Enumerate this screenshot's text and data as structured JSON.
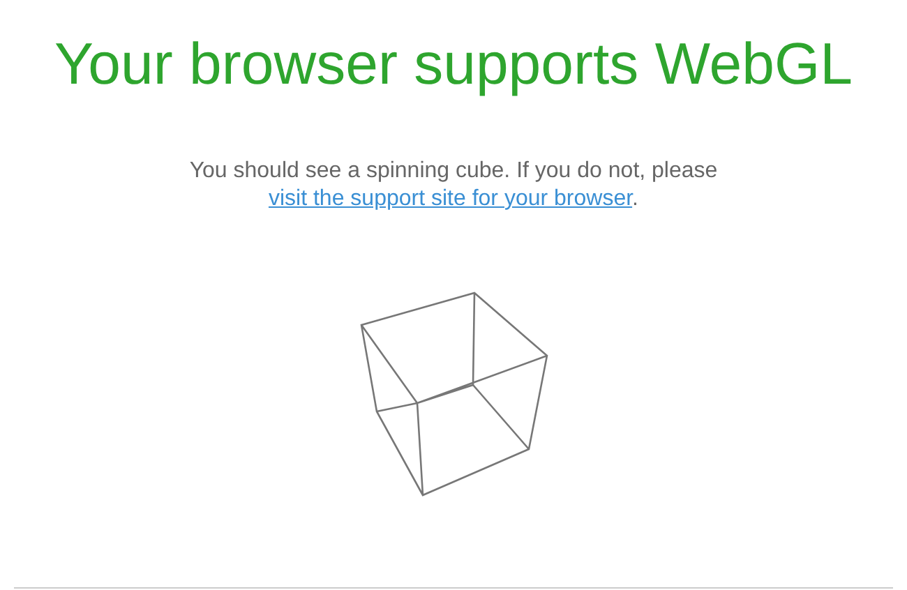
{
  "title": "Your browser supports WebGL",
  "message": {
    "text": "You should see a spinning cube. If you do not, please",
    "link": "visit the support site for your browser",
    "after": "."
  }
}
